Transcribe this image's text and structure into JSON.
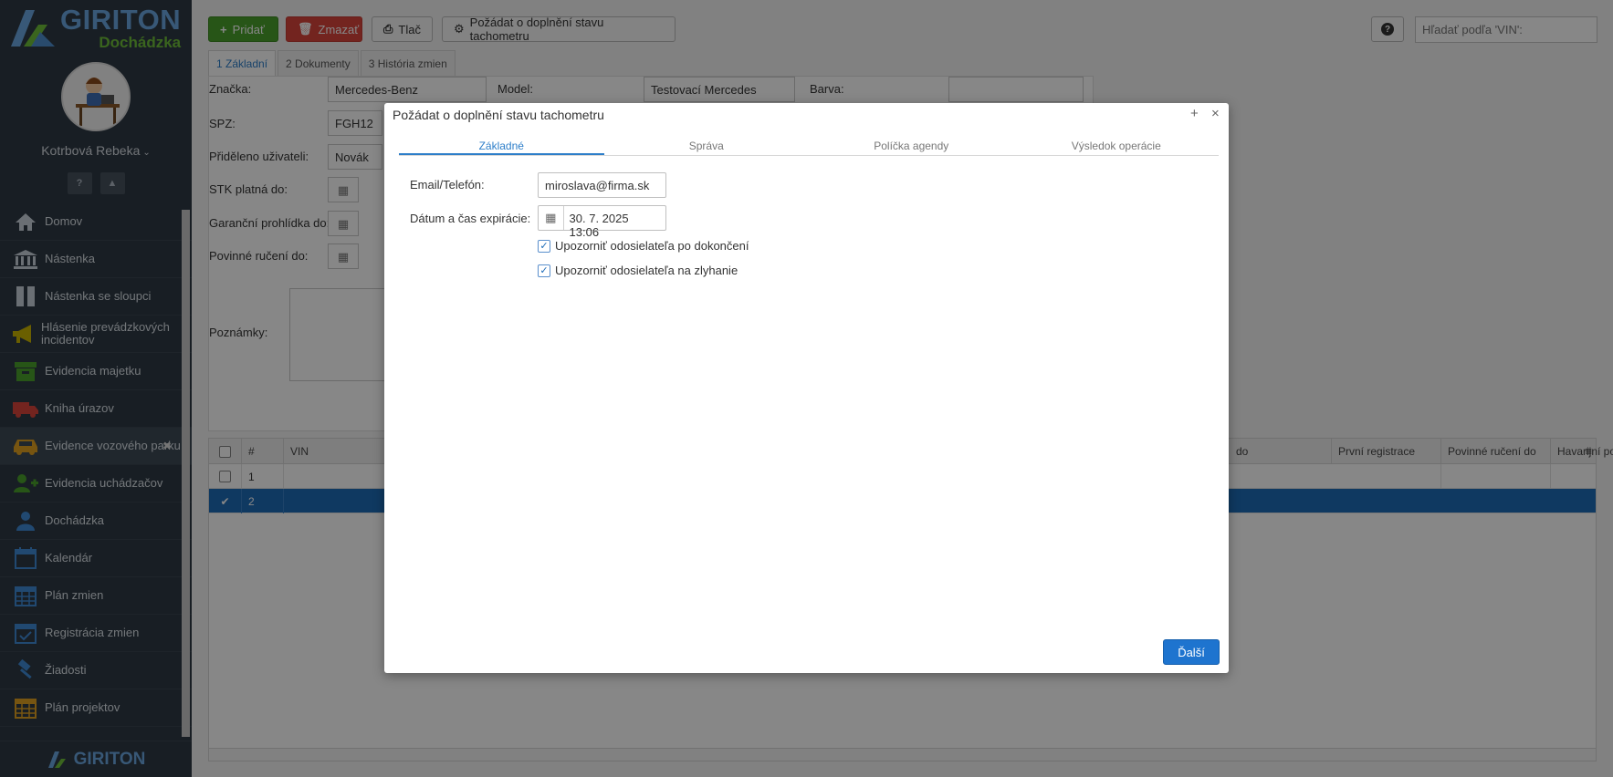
{
  "app": {
    "logo_title": "GIRITON",
    "logo_subtitle": "Dochádzka",
    "bottom_logo": "GIRITON"
  },
  "user": {
    "name": "Kotrbová Rebeka",
    "help_glyph": "?",
    "bell_glyph": "▲"
  },
  "sidebar": {
    "items": [
      {
        "label": "Domov",
        "icon": "home-icon"
      },
      {
        "label": "Nástenka",
        "icon": "bank-icon"
      },
      {
        "label": "Nástenka se sloupci",
        "icon": "columns-icon"
      },
      {
        "label": "Hlásenie prevádzkových incidentov",
        "icon": "megaphone-icon"
      },
      {
        "label": "Evidencia majetku",
        "icon": "archive-icon"
      },
      {
        "label": "Kniha úrazov",
        "icon": "ambulance-icon"
      },
      {
        "label": "Evidence vozového parku",
        "icon": "car-icon"
      },
      {
        "label": "Evidencia uchádzačov",
        "icon": "user-plus-icon"
      },
      {
        "label": "Dochádzka",
        "icon": "user-icon"
      },
      {
        "label": "Kalendár",
        "icon": "calendar-icon"
      },
      {
        "label": "Plán zmien",
        "icon": "calendar-grid-icon"
      },
      {
        "label": "Registrácia zmien",
        "icon": "calendar-check-icon"
      },
      {
        "label": "Žiadosti",
        "icon": "gavel-icon"
      },
      {
        "label": "Plán projektov",
        "icon": "calendar-project-icon"
      }
    ],
    "close_glyph": "✖"
  },
  "toolbar": {
    "add": "Pridať",
    "delete": "Zmazať",
    "print": "Tlač",
    "request": "Požádat o doplnění stavu tachometru",
    "help": "?",
    "search_placeholder": "Hľadať podľa 'VIN':"
  },
  "tabs": [
    "1 Základní",
    "2 Dokumenty",
    "3 História zmien"
  ],
  "form": {
    "brand_label": "Značka:",
    "brand_value": "Mercedes-Benz",
    "model_label": "Model:",
    "model_value": "Testovací Mercedes",
    "color_label": "Barva:",
    "spz_label": "SPZ:",
    "spz_value": "FGH12",
    "assigned_label": "Přiděleno uživateli:",
    "assigned_value": "Novák",
    "stk_label": "STK platná do:",
    "warranty_label": "Garanční prohlídka do:",
    "insurance_label": "Povinné ručení do:",
    "notes_label": "Poznámky:"
  },
  "grid": {
    "columns": [
      "#",
      "VIN",
      "do",
      "První registrace",
      "Povinné ručení do",
      "Havarijní pojiště"
    ],
    "rows": [
      {
        "num": "1",
        "selected": false
      },
      {
        "num": "2",
        "selected": true
      }
    ]
  },
  "modal": {
    "title": "Požádat o doplnění stavu tachometru",
    "plus": "+",
    "close": "×",
    "tabs": [
      "Základné",
      "Správa",
      "Políčka agendy",
      "Výsledok operácie"
    ],
    "email_label": "Email/Telefón:",
    "email_value": "miroslava@firma.sk",
    "expiry_label": "Dátum a čas expirácie:",
    "expiry_value": "30. 7. 2025 13:06",
    "notify_done": "Upozorniť odosielateľa po dokončení",
    "notify_fail": "Upozorniť odosielateľa na zlyhanie",
    "next": "Ďalší"
  },
  "colors": {
    "sidebar_bg": "#2f3a45",
    "accent_blue": "#1e74cf",
    "add_green": "#4aa02c",
    "delete_red": "#d9453c",
    "logo_blue": "#6aa6e0",
    "logo_green": "#6fbf3a"
  }
}
